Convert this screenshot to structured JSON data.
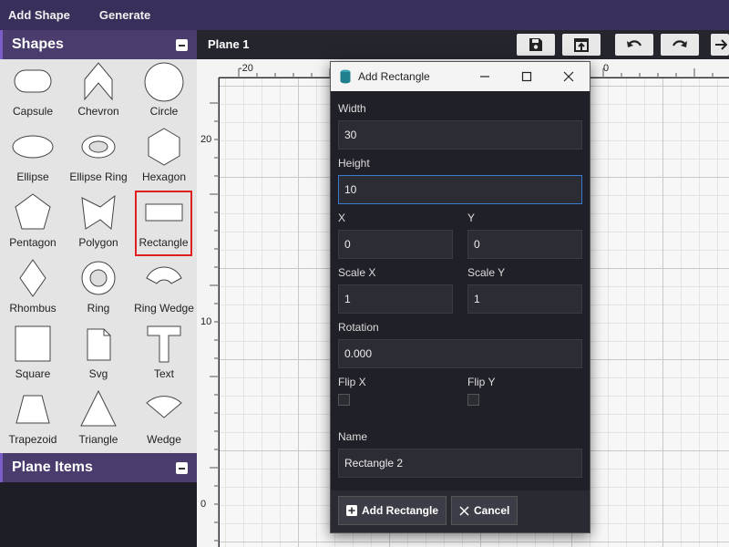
{
  "menubar": {
    "items": [
      "Add Shape",
      "Generate"
    ]
  },
  "shapes_panel": {
    "title": "Shapes",
    "shapes": [
      "Capsule",
      "Chevron",
      "Circle",
      "Ellipse",
      "Ellipse Ring",
      "Hexagon",
      "Pentagon",
      "Polygon",
      "Rectangle",
      "Rhombus",
      "Ring",
      "Ring Wedge",
      "Square",
      "Svg",
      "Text",
      "Trapezoid",
      "Triangle",
      "Wedge"
    ],
    "selected": "Rectangle"
  },
  "plane_items_panel": {
    "title": "Plane Items"
  },
  "canvas": {
    "plane_tab": "Plane 1",
    "toolbar_icons": [
      "save-icon",
      "export-icon",
      "undo-icon",
      "redo-icon",
      "arrow-right-icon"
    ],
    "ruler_top_labels": [
      "-20",
      "0"
    ],
    "ruler_left_labels": [
      "20",
      "10",
      "0"
    ]
  },
  "dialog": {
    "title": "Add Rectangle",
    "fields": {
      "width": {
        "label": "Width",
        "value": "30"
      },
      "height": {
        "label": "Height",
        "value": "10"
      },
      "x": {
        "label": "X",
        "value": "0"
      },
      "y": {
        "label": "Y",
        "value": "0"
      },
      "scale_x": {
        "label": "Scale X",
        "value": "1"
      },
      "scale_y": {
        "label": "Scale Y",
        "value": "1"
      },
      "rotation": {
        "label": "Rotation",
        "value": "0.000"
      },
      "flip_x": {
        "label": "Flip X"
      },
      "flip_y": {
        "label": "Flip Y"
      },
      "name": {
        "label": "Name",
        "value": "Rectangle 2"
      }
    },
    "buttons": {
      "add": "Add Rectangle",
      "cancel": "Cancel"
    }
  },
  "colors": {
    "menubar": "#3a2f5a",
    "panel_header": "#4a3d6e",
    "selected_outline": "#e02020",
    "focus_border": "#3d7bd0"
  }
}
